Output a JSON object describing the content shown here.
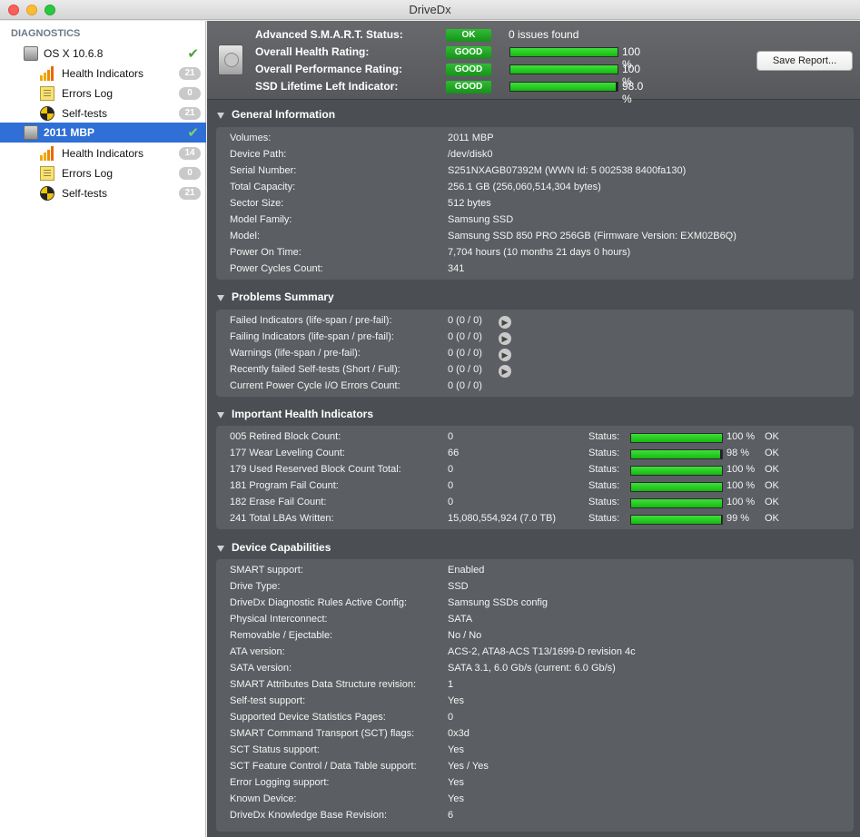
{
  "window": {
    "title": "DriveDx"
  },
  "sidebar": {
    "heading": "DIAGNOSTICS",
    "disks": [
      {
        "name": "OS X 10.6.8",
        "selected": false,
        "items": [
          {
            "label": "Health Indicators",
            "count": "21"
          },
          {
            "label": "Errors Log",
            "count": "0"
          },
          {
            "label": "Self-tests",
            "count": "21"
          }
        ]
      },
      {
        "name": "2011 MBP",
        "selected": true,
        "items": [
          {
            "label": "Health Indicators",
            "count": "14"
          },
          {
            "label": "Errors Log",
            "count": "0"
          },
          {
            "label": "Self-tests",
            "count": "21"
          }
        ]
      }
    ]
  },
  "status": {
    "smart": {
      "label": "Advanced S.M.A.R.T. Status:",
      "badge": "OK",
      "info": "0 issues found"
    },
    "health": {
      "label": "Overall Health Rating:",
      "badge": "GOOD",
      "percent": 100,
      "percent_text": "100 %"
    },
    "performance": {
      "label": "Overall Performance Rating:",
      "badge": "GOOD",
      "percent": 100,
      "percent_text": "100 %"
    },
    "lifetime": {
      "label": "SSD Lifetime Left Indicator:",
      "badge": "GOOD",
      "percent": 98,
      "percent_text": "98.0 %"
    },
    "save_button": "Save Report..."
  },
  "general": {
    "title": "General Information",
    "rows": [
      {
        "k": "Volumes:",
        "v": "2011 MBP"
      },
      {
        "k": "Device Path:",
        "v": "/dev/disk0"
      },
      {
        "k": "Serial Number:",
        "v": "S251NXAGB07392M (WWN Id: 5 002538 8400fa130)"
      },
      {
        "k": "Total Capacity:",
        "v": "256.1 GB (256,060,514,304 bytes)"
      },
      {
        "k": "Sector Size:",
        "v": "512 bytes"
      },
      {
        "k": "Model Family:",
        "v": "Samsung SSD"
      },
      {
        "k": "Model:",
        "v": "Samsung SSD 850 PRO 256GB  (Firmware Version: EXM02B6Q)"
      },
      {
        "k": "Power On Time:",
        "v": "7,704 hours (10 months 21 days 0 hours)"
      },
      {
        "k": "Power Cycles Count:",
        "v": "341"
      }
    ]
  },
  "problems": {
    "title": "Problems Summary",
    "rows": [
      {
        "k": "Failed Indicators (life-span / pre-fail):",
        "v": "0 (0 / 0)",
        "arrow": true
      },
      {
        "k": "Failing Indicators (life-span / pre-fail):",
        "v": "0 (0 / 0)",
        "arrow": true
      },
      {
        "k": "Warnings (life-span / pre-fail):",
        "v": "0 (0 / 0)",
        "arrow": true
      },
      {
        "k": "Recently failed Self-tests (Short / Full):",
        "v": "0 (0 / 0)",
        "arrow": true
      },
      {
        "k": "Current Power Cycle I/O Errors Count:",
        "v": "0 (0 / 0)",
        "arrow": false
      }
    ]
  },
  "health": {
    "title": "Important Health Indicators",
    "status_label": "Status:",
    "rows": [
      {
        "k": "005  Retired Block Count:",
        "v": "0",
        "percent": 100,
        "pct": "100 %",
        "ok": "OK"
      },
      {
        "k": "177  Wear Leveling Count:",
        "v": "66",
        "percent": 98,
        "pct": "98 %",
        "ok": "OK"
      },
      {
        "k": "179  Used Reserved Block Count Total:",
        "v": "0",
        "percent": 100,
        "pct": "100 %",
        "ok": "OK"
      },
      {
        "k": "181  Program Fail Count:",
        "v": "0",
        "percent": 100,
        "pct": "100 %",
        "ok": "OK"
      },
      {
        "k": "182  Erase Fail Count:",
        "v": "0",
        "percent": 100,
        "pct": "100 %",
        "ok": "OK"
      },
      {
        "k": "241  Total LBAs Written:",
        "v": "15,080,554,924 (7.0 TB)",
        "percent": 99,
        "pct": "99 %",
        "ok": "OK"
      }
    ]
  },
  "capabilities": {
    "title": "Device Capabilities",
    "rows": [
      {
        "k": "SMART support:",
        "v": "Enabled"
      },
      {
        "k": "Drive Type:",
        "v": "SSD"
      },
      {
        "k": "DriveDx Diagnostic Rules Active Config:",
        "v": "Samsung SSDs config"
      },
      {
        "k": "Physical Interconnect:",
        "v": "SATA"
      },
      {
        "k": "Removable / Ejectable:",
        "v": "No / No"
      },
      {
        "k": "ATA version:",
        "v": "ACS-2, ATA8-ACS T13/1699-D revision 4c"
      },
      {
        "k": "SATA version:",
        "v": "SATA 3.1, 6.0 Gb/s (current: 6.0 Gb/s)"
      },
      {
        "k": "SMART Attributes Data Structure revision:",
        "v": "1"
      },
      {
        "k": "Self-test support:",
        "v": "Yes"
      },
      {
        "k": "Supported Device Statistics Pages:",
        "v": "0"
      },
      {
        "k": "SMART Command Transport (SCT) flags:",
        "v": "0x3d"
      },
      {
        "k": "SCT Status support:",
        "v": "Yes"
      },
      {
        "k": "SCT Feature Control / Data Table support:",
        "v": "Yes / Yes"
      },
      {
        "k": "Error Logging support:",
        "v": "Yes"
      },
      {
        "k": "Known Device:",
        "v": "Yes"
      },
      {
        "k": "DriveDx Knowledge Base Revision:",
        "v": "6"
      }
    ]
  }
}
